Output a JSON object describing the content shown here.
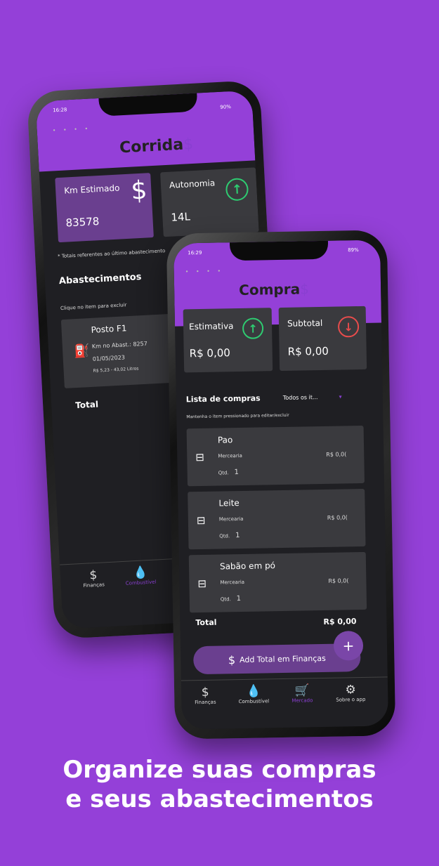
{
  "colors": {
    "background": "#9440d8",
    "accent": "#8a3fd1",
    "green": "#2ecc71",
    "red": "#e84c4c"
  },
  "back_phone": {
    "status_time": "16:28",
    "status_battery": "90%",
    "brand": "Corrida",
    "brand_symbol": "$",
    "card_km": {
      "label": "Km Estimado",
      "value": "83578",
      "icon": "dollar-icon"
    },
    "card_autonomia": {
      "label": "Autonomia",
      "value": "14L",
      "icon": "arrow-up-circle-icon"
    },
    "note": "* Totais referentes ao último abastecimento",
    "section_title": "Abastecimentos",
    "section_hint": "Clique no item para excluir",
    "entry": {
      "title": "Posto F1",
      "line1": "Km no Abast.: 8257",
      "line2": "01/05/2023",
      "line3": "R$ 5,23 - 43,02 Litros"
    },
    "total_label": "Total",
    "tabs": [
      {
        "label": "Finanças",
        "icon": "$"
      },
      {
        "label": "Combustível",
        "icon": "💧"
      }
    ]
  },
  "front_phone": {
    "status_time": "16:29",
    "status_battery": "89%",
    "brand": "Compra",
    "brand_symbol": "$",
    "card_estimativa": {
      "label": "Estimativa",
      "value": "R$ 0,00",
      "icon": "arrow-up-circle-icon"
    },
    "card_subtotal": {
      "label": "Subtotal",
      "value": "R$ 0,00",
      "icon": "arrow-down-circle-icon"
    },
    "list_title": "Lista de compras",
    "filter": "Todos os it...",
    "list_hint": "Mantenha o item pressionado para editar/excluir",
    "items": [
      {
        "name": "Pao",
        "category": "Mercearia",
        "qty_label": "Qtd.",
        "qty": "1",
        "price": "R$ 0,0("
      },
      {
        "name": "Leite",
        "category": "Mercearia",
        "qty_label": "Qtd.",
        "qty": "1",
        "price": "R$ 0,0("
      },
      {
        "name": "Sabão em pó",
        "category": "Mercearia",
        "qty_label": "Qtd.",
        "qty": "1",
        "price": "R$ 0,0("
      }
    ],
    "total_label": "Total",
    "total_value": "R$ 0,00",
    "add_button": "Add Total em Finanças",
    "fab": "+",
    "tabs": [
      {
        "label": "Finanças",
        "icon": "$"
      },
      {
        "label": "Combustível",
        "icon": "💧"
      },
      {
        "label": "Mercado",
        "icon": "🛒"
      },
      {
        "label": "Sobre o app",
        "icon": "⚙"
      }
    ]
  },
  "caption": {
    "line1": "Organize suas compras",
    "line2": "e seus abastecimentos"
  }
}
